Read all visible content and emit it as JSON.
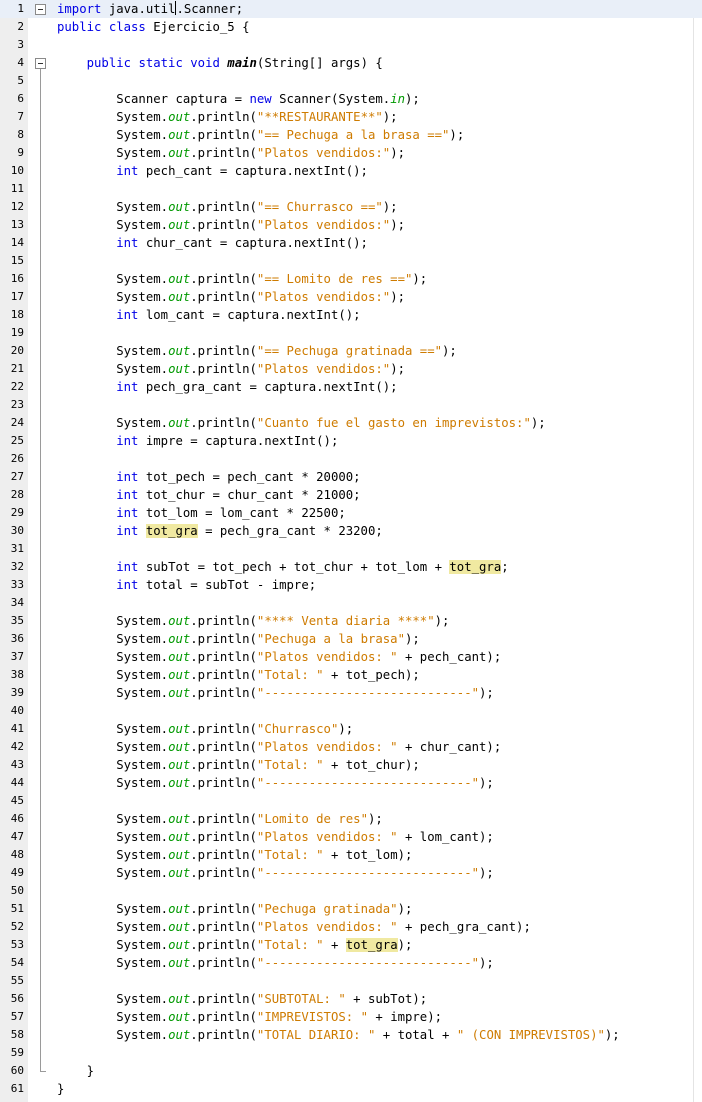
{
  "editor": {
    "current_line": 1,
    "fold_markers": [
      1,
      4
    ],
    "fold_end_line": 60,
    "lines": [
      [
        {
          "t": "import",
          "c": "kw"
        },
        {
          "t": " java.util"
        },
        {
          "caret": true
        },
        {
          "t": ".Scanner;"
        }
      ],
      [
        {
          "t": "public class",
          "c": "kw"
        },
        {
          "t": " Ejercicio_5 {"
        }
      ],
      [],
      [
        {
          "t": "    "
        },
        {
          "t": "public static void",
          "c": "kw"
        },
        {
          "t": " "
        },
        {
          "t": "main",
          "c": "mth"
        },
        {
          "t": "(String[] args) {"
        }
      ],
      [],
      [
        {
          "t": "        Scanner captura = "
        },
        {
          "t": "new",
          "c": "kw"
        },
        {
          "t": " Scanner(System."
        },
        {
          "t": "in",
          "c": "fld"
        },
        {
          "t": ");"
        }
      ],
      [
        {
          "t": "        System."
        },
        {
          "t": "out",
          "c": "fld"
        },
        {
          "t": ".println("
        },
        {
          "t": "\"**RESTAURANTE**\"",
          "c": "str"
        },
        {
          "t": ");"
        }
      ],
      [
        {
          "t": "        System."
        },
        {
          "t": "out",
          "c": "fld"
        },
        {
          "t": ".println("
        },
        {
          "t": "\"== Pechuga a la brasa ==\"",
          "c": "str"
        },
        {
          "t": ");"
        }
      ],
      [
        {
          "t": "        System."
        },
        {
          "t": "out",
          "c": "fld"
        },
        {
          "t": ".println("
        },
        {
          "t": "\"Platos vendidos:\"",
          "c": "str"
        },
        {
          "t": ");"
        }
      ],
      [
        {
          "t": "        "
        },
        {
          "t": "int",
          "c": "kw"
        },
        {
          "t": " pech_cant = captura.nextInt();"
        }
      ],
      [],
      [
        {
          "t": "        System."
        },
        {
          "t": "out",
          "c": "fld"
        },
        {
          "t": ".println("
        },
        {
          "t": "\"== Churrasco ==\"",
          "c": "str"
        },
        {
          "t": ");"
        }
      ],
      [
        {
          "t": "        System."
        },
        {
          "t": "out",
          "c": "fld"
        },
        {
          "t": ".println("
        },
        {
          "t": "\"Platos vendidos:\"",
          "c": "str"
        },
        {
          "t": ");"
        }
      ],
      [
        {
          "t": "        "
        },
        {
          "t": "int",
          "c": "kw"
        },
        {
          "t": " chur_cant = captura.nextInt();"
        }
      ],
      [],
      [
        {
          "t": "        System."
        },
        {
          "t": "out",
          "c": "fld"
        },
        {
          "t": ".println("
        },
        {
          "t": "\"== Lomito de res ==\"",
          "c": "str"
        },
        {
          "t": ");"
        }
      ],
      [
        {
          "t": "        System."
        },
        {
          "t": "out",
          "c": "fld"
        },
        {
          "t": ".println("
        },
        {
          "t": "\"Platos vendidos:\"",
          "c": "str"
        },
        {
          "t": ");"
        }
      ],
      [
        {
          "t": "        "
        },
        {
          "t": "int",
          "c": "kw"
        },
        {
          "t": " lom_cant = captura.nextInt();"
        }
      ],
      [],
      [
        {
          "t": "        System."
        },
        {
          "t": "out",
          "c": "fld"
        },
        {
          "t": ".println("
        },
        {
          "t": "\"== Pechuga gratinada ==\"",
          "c": "str"
        },
        {
          "t": ");"
        }
      ],
      [
        {
          "t": "        System."
        },
        {
          "t": "out",
          "c": "fld"
        },
        {
          "t": ".println("
        },
        {
          "t": "\"Platos vendidos:\"",
          "c": "str"
        },
        {
          "t": ");"
        }
      ],
      [
        {
          "t": "        "
        },
        {
          "t": "int",
          "c": "kw"
        },
        {
          "t": " pech_gra_cant = captura.nextInt();"
        }
      ],
      [],
      [
        {
          "t": "        System."
        },
        {
          "t": "out",
          "c": "fld"
        },
        {
          "t": ".println("
        },
        {
          "t": "\"Cuanto fue el gasto en imprevistos:\"",
          "c": "str"
        },
        {
          "t": ");"
        }
      ],
      [
        {
          "t": "        "
        },
        {
          "t": "int",
          "c": "kw"
        },
        {
          "t": " impre = captura.nextInt();"
        }
      ],
      [],
      [
        {
          "t": "        "
        },
        {
          "t": "int",
          "c": "kw"
        },
        {
          "t": " tot_pech = pech_cant * 20000;"
        }
      ],
      [
        {
          "t": "        "
        },
        {
          "t": "int",
          "c": "kw"
        },
        {
          "t": " tot_chur = chur_cant * 21000;"
        }
      ],
      [
        {
          "t": "        "
        },
        {
          "t": "int",
          "c": "kw"
        },
        {
          "t": " tot_lom = lom_cant * 22500;"
        }
      ],
      [
        {
          "t": "        "
        },
        {
          "t": "int",
          "c": "kw"
        },
        {
          "t": " "
        },
        {
          "t": "tot_gra",
          "c": "hl"
        },
        {
          "t": " = pech_gra_cant * 23200;"
        }
      ],
      [],
      [
        {
          "t": "        "
        },
        {
          "t": "int",
          "c": "kw"
        },
        {
          "t": " subTot = tot_pech + tot_chur + tot_lom + "
        },
        {
          "t": "tot_gra",
          "c": "hl"
        },
        {
          "t": ";"
        }
      ],
      [
        {
          "t": "        "
        },
        {
          "t": "int",
          "c": "kw"
        },
        {
          "t": " total = subTot - impre;"
        }
      ],
      [],
      [
        {
          "t": "        System."
        },
        {
          "t": "out",
          "c": "fld"
        },
        {
          "t": ".println("
        },
        {
          "t": "\"**** Venta diaria ****\"",
          "c": "str"
        },
        {
          "t": ");"
        }
      ],
      [
        {
          "t": "        System."
        },
        {
          "t": "out",
          "c": "fld"
        },
        {
          "t": ".println("
        },
        {
          "t": "\"Pechuga a la brasa\"",
          "c": "str"
        },
        {
          "t": ");"
        }
      ],
      [
        {
          "t": "        System."
        },
        {
          "t": "out",
          "c": "fld"
        },
        {
          "t": ".println("
        },
        {
          "t": "\"Platos vendidos: \"",
          "c": "str"
        },
        {
          "t": " + pech_cant);"
        }
      ],
      [
        {
          "t": "        System."
        },
        {
          "t": "out",
          "c": "fld"
        },
        {
          "t": ".println("
        },
        {
          "t": "\"Total: \"",
          "c": "str"
        },
        {
          "t": " + tot_pech);"
        }
      ],
      [
        {
          "t": "        System."
        },
        {
          "t": "out",
          "c": "fld"
        },
        {
          "t": ".println("
        },
        {
          "t": "\"----------------------------\"",
          "c": "str"
        },
        {
          "t": ");"
        }
      ],
      [],
      [
        {
          "t": "        System."
        },
        {
          "t": "out",
          "c": "fld"
        },
        {
          "t": ".println("
        },
        {
          "t": "\"Churrasco\"",
          "c": "str"
        },
        {
          "t": ");"
        }
      ],
      [
        {
          "t": "        System."
        },
        {
          "t": "out",
          "c": "fld"
        },
        {
          "t": ".println("
        },
        {
          "t": "\"Platos vendidos: \"",
          "c": "str"
        },
        {
          "t": " + chur_cant);"
        }
      ],
      [
        {
          "t": "        System."
        },
        {
          "t": "out",
          "c": "fld"
        },
        {
          "t": ".println("
        },
        {
          "t": "\"Total: \"",
          "c": "str"
        },
        {
          "t": " + tot_chur);"
        }
      ],
      [
        {
          "t": "        System."
        },
        {
          "t": "out",
          "c": "fld"
        },
        {
          "t": ".println("
        },
        {
          "t": "\"----------------------------\"",
          "c": "str"
        },
        {
          "t": ");"
        }
      ],
      [],
      [
        {
          "t": "        System."
        },
        {
          "t": "out",
          "c": "fld"
        },
        {
          "t": ".println("
        },
        {
          "t": "\"Lomito de res\"",
          "c": "str"
        },
        {
          "t": ");"
        }
      ],
      [
        {
          "t": "        System."
        },
        {
          "t": "out",
          "c": "fld"
        },
        {
          "t": ".println("
        },
        {
          "t": "\"Platos vendidos: \"",
          "c": "str"
        },
        {
          "t": " + lom_cant);"
        }
      ],
      [
        {
          "t": "        System."
        },
        {
          "t": "out",
          "c": "fld"
        },
        {
          "t": ".println("
        },
        {
          "t": "\"Total: \"",
          "c": "str"
        },
        {
          "t": " + tot_lom);"
        }
      ],
      [
        {
          "t": "        System."
        },
        {
          "t": "out",
          "c": "fld"
        },
        {
          "t": ".println("
        },
        {
          "t": "\"----------------------------\"",
          "c": "str"
        },
        {
          "t": ");"
        }
      ],
      [],
      [
        {
          "t": "        System."
        },
        {
          "t": "out",
          "c": "fld"
        },
        {
          "t": ".println("
        },
        {
          "t": "\"Pechuga gratinada\"",
          "c": "str"
        },
        {
          "t": ");"
        }
      ],
      [
        {
          "t": "        System."
        },
        {
          "t": "out",
          "c": "fld"
        },
        {
          "t": ".println("
        },
        {
          "t": "\"Platos vendidos: \"",
          "c": "str"
        },
        {
          "t": " + pech_gra_cant);"
        }
      ],
      [
        {
          "t": "        System."
        },
        {
          "t": "out",
          "c": "fld"
        },
        {
          "t": ".println("
        },
        {
          "t": "\"Total: \"",
          "c": "str"
        },
        {
          "t": " + "
        },
        {
          "t": "tot_gra",
          "c": "hl"
        },
        {
          "t": ");"
        }
      ],
      [
        {
          "t": "        System."
        },
        {
          "t": "out",
          "c": "fld"
        },
        {
          "t": ".println("
        },
        {
          "t": "\"----------------------------\"",
          "c": "str"
        },
        {
          "t": ");"
        }
      ],
      [],
      [
        {
          "t": "        System."
        },
        {
          "t": "out",
          "c": "fld"
        },
        {
          "t": ".println("
        },
        {
          "t": "\"SUBTOTAL: \"",
          "c": "str"
        },
        {
          "t": " + subTot);"
        }
      ],
      [
        {
          "t": "        System."
        },
        {
          "t": "out",
          "c": "fld"
        },
        {
          "t": ".println("
        },
        {
          "t": "\"IMPREVISTOS: \"",
          "c": "str"
        },
        {
          "t": " + impre);"
        }
      ],
      [
        {
          "t": "        System."
        },
        {
          "t": "out",
          "c": "fld"
        },
        {
          "t": ".println("
        },
        {
          "t": "\"TOTAL DIARIO: \"",
          "c": "str"
        },
        {
          "t": " + total + "
        },
        {
          "t": "\" (CON IMPREVISTOS)\"",
          "c": "str"
        },
        {
          "t": ");"
        }
      ],
      [],
      [
        {
          "t": "    }"
        }
      ],
      [
        {
          "t": "}"
        }
      ]
    ]
  }
}
